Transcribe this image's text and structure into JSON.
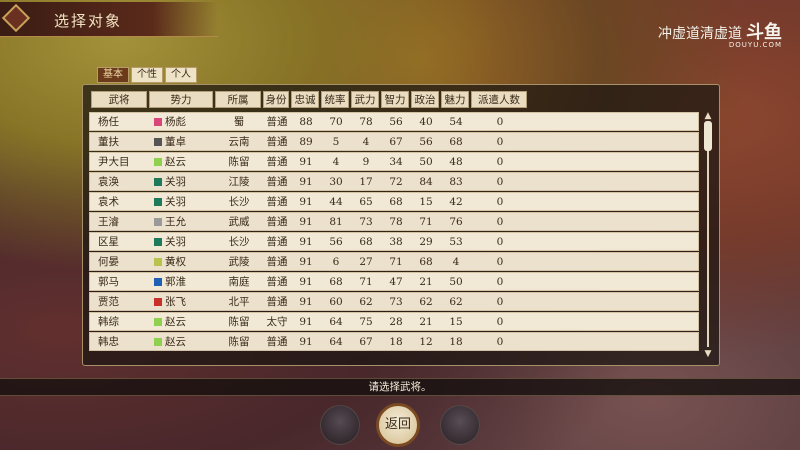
{
  "title": "选择对象",
  "watermark": {
    "main": "冲虚道清虚道",
    "logo": "斗鱼",
    "sub": "DOUYU.COM"
  },
  "tabs": [
    "基本",
    "个性",
    "个人"
  ],
  "columns": [
    "武将",
    "势力",
    "所属",
    "身份",
    "忠诚",
    "统率",
    "武力",
    "智力",
    "政治",
    "魅力",
    "派遣人数"
  ],
  "rows": [
    {
      "name": "杨任",
      "force": "杨彪",
      "force_color": "#d9477a",
      "affil": "蜀",
      "status": "普通",
      "loyalty": "88",
      "lead": "70",
      "war": "78",
      "int": "56",
      "pol": "40",
      "cha": "54",
      "dispatch": "0"
    },
    {
      "name": "董扶",
      "force": "董卓",
      "force_color": "#555555",
      "affil": "云南",
      "status": "普通",
      "loyalty": "89",
      "lead": "5",
      "war": "4",
      "int": "67",
      "pol": "56",
      "cha": "68",
      "dispatch": "0"
    },
    {
      "name": "尹大目",
      "force": "赵云",
      "force_color": "#8fd14f",
      "affil": "陈留",
      "status": "普通",
      "loyalty": "91",
      "lead": "4",
      "war": "9",
      "int": "34",
      "pol": "50",
      "cha": "48",
      "dispatch": "0"
    },
    {
      "name": "袁涣",
      "force": "关羽",
      "force_color": "#1d7a5a",
      "affil": "江陵",
      "status": "普通",
      "loyalty": "91",
      "lead": "30",
      "war": "17",
      "int": "72",
      "pol": "84",
      "cha": "83",
      "dispatch": "0"
    },
    {
      "name": "袁术",
      "force": "关羽",
      "force_color": "#1d7a5a",
      "affil": "长沙",
      "status": "普通",
      "loyalty": "91",
      "lead": "44",
      "war": "65",
      "int": "68",
      "pol": "15",
      "cha": "42",
      "dispatch": "0"
    },
    {
      "name": "王濬",
      "force": "王允",
      "force_color": "#9a9a9a",
      "affil": "武威",
      "status": "普通",
      "loyalty": "91",
      "lead": "81",
      "war": "73",
      "int": "78",
      "pol": "71",
      "cha": "76",
      "dispatch": "0"
    },
    {
      "name": "区星",
      "force": "关羽",
      "force_color": "#1d7a5a",
      "affil": "长沙",
      "status": "普通",
      "loyalty": "91",
      "lead": "56",
      "war": "68",
      "int": "38",
      "pol": "29",
      "cha": "53",
      "dispatch": "0"
    },
    {
      "name": "何晏",
      "force": "黄权",
      "force_color": "#b9c24a",
      "affil": "武陵",
      "status": "普通",
      "loyalty": "91",
      "lead": "6",
      "war": "27",
      "int": "71",
      "pol": "68",
      "cha": "4",
      "dispatch": "0"
    },
    {
      "name": "郭马",
      "force": "郭淮",
      "force_color": "#1f5fb4",
      "affil": "南庭",
      "status": "普通",
      "loyalty": "91",
      "lead": "68",
      "war": "71",
      "int": "47",
      "pol": "21",
      "cha": "50",
      "dispatch": "0"
    },
    {
      "name": "贾范",
      "force": "张飞",
      "force_color": "#c8302a",
      "affil": "北平",
      "status": "普通",
      "loyalty": "91",
      "lead": "60",
      "war": "62",
      "int": "73",
      "pol": "62",
      "cha": "62",
      "dispatch": "0"
    },
    {
      "name": "韩综",
      "force": "赵云",
      "force_color": "#8fd14f",
      "affil": "陈留",
      "status": "太守",
      "loyalty": "91",
      "lead": "64",
      "war": "75",
      "int": "28",
      "pol": "21",
      "cha": "15",
      "dispatch": "0"
    },
    {
      "name": "韩忠",
      "force": "赵云",
      "force_color": "#8fd14f",
      "affil": "陈留",
      "status": "普通",
      "loyalty": "91",
      "lead": "64",
      "war": "67",
      "int": "18",
      "pol": "12",
      "cha": "18",
      "dispatch": "0"
    }
  ],
  "status_message": "请选择武将。",
  "back_label": "返回"
}
